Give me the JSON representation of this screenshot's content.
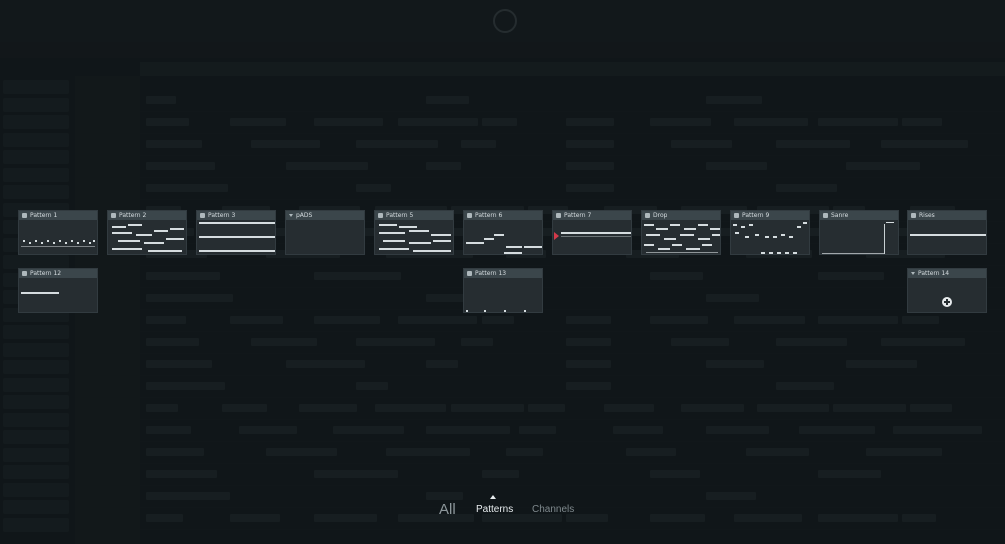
{
  "picker": {
    "tiles": [
      {
        "label": "Pattern 1",
        "icon": "piano-roll-icon"
      },
      {
        "label": "Pattern 2",
        "icon": "piano-roll-icon"
      },
      {
        "label": "Pattern 3",
        "icon": "piano-roll-icon"
      },
      {
        "label": "pADS",
        "icon": "chevron-down-icon"
      },
      {
        "label": "Pattern 5",
        "icon": "piano-roll-icon"
      },
      {
        "label": "Pattern 6",
        "icon": "piano-roll-icon"
      },
      {
        "label": "Pattern 7",
        "icon": "piano-roll-icon"
      },
      {
        "label": "Drop",
        "icon": "piano-roll-icon"
      },
      {
        "label": "Pattern 9",
        "icon": "piano-roll-icon"
      },
      {
        "label": "Sanre",
        "icon": "piano-roll-icon"
      },
      {
        "label": "Rises",
        "icon": "piano-roll-icon"
      },
      {
        "label": "Pattern 12",
        "icon": "piano-roll-icon"
      },
      {
        "label": "Pattern 13",
        "icon": "piano-roll-icon"
      },
      {
        "label": "Pattern 14",
        "icon": "chevron-down-icon"
      }
    ]
  },
  "tabs": {
    "all": "All",
    "patterns": "Patterns",
    "channels": "Channels",
    "active": "patterns"
  },
  "colors": {
    "accent": "#d33a4a",
    "background": "#1a2024",
    "tile": "#262d31",
    "tile_header": "#3b464b"
  }
}
